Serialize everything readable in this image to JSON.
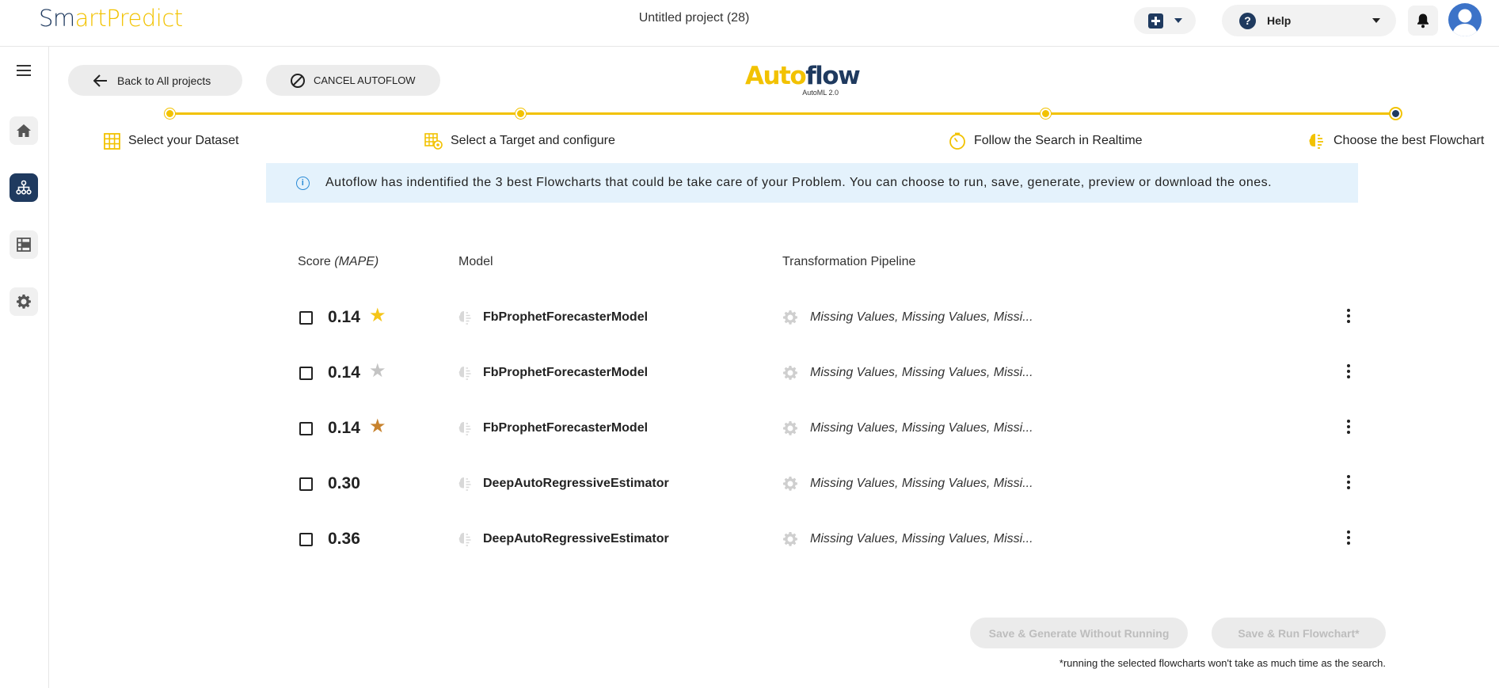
{
  "header": {
    "logo_smart": "Sm",
    "logo_art": "art",
    "logo_predict": "Predict",
    "project_title": "Untitled project (28)",
    "help_label": "Help"
  },
  "actions": {
    "back_label": "Back to All projects",
    "cancel_label": "CANCEL AUTOFLOW"
  },
  "autoflow": {
    "title_a": "Auto",
    "title_b": "flow",
    "subtitle": "AutoML 2.0"
  },
  "steps": [
    {
      "label": "Select your Dataset",
      "icon": "grid-icon"
    },
    {
      "label": "Select a Target and configure",
      "icon": "target-table-icon"
    },
    {
      "label": "Follow the Search in Realtime",
      "icon": "timer-icon"
    },
    {
      "label": "Choose the best Flowchart",
      "icon": "brain-icon"
    }
  ],
  "banner": {
    "text": "Autoflow has indentified the 3 best Flowcharts that could be take care of your Problem. You can choose to run, save, generate, preview or download the ones."
  },
  "table": {
    "headers": {
      "score": "Score",
      "score_metric": "(MAPE)",
      "model": "Model",
      "pipeline": "Transformation Pipeline"
    },
    "rows": [
      {
        "score": "0.14",
        "medal": "gold",
        "medal_color": "#f5c518",
        "model": "FbProphetForecasterModel",
        "pipeline": "Missing Values, Missing Values, Missi..."
      },
      {
        "score": "0.14",
        "medal": "silver",
        "medal_color": "#c4c4c4",
        "model": "FbProphetForecasterModel",
        "pipeline": "Missing Values, Missing Values, Missi..."
      },
      {
        "score": "0.14",
        "medal": "bronze",
        "medal_color": "#c8832e",
        "model": "FbProphetForecasterModel",
        "pipeline": "Missing Values, Missing Values, Missi..."
      },
      {
        "score": "0.30",
        "medal": "",
        "medal_color": "",
        "model": "DeepAutoRegressiveEstimator",
        "pipeline": "Missing Values, Missing Values, Missi..."
      },
      {
        "score": "0.36",
        "medal": "",
        "medal_color": "",
        "model": "DeepAutoRegressiveEstimator",
        "pipeline": "Missing Values, Missing Values, Missi..."
      }
    ]
  },
  "footer": {
    "save_generate_label": "Save & Generate Without Running",
    "save_run_label": "Save & Run Flowchart*",
    "note": "*running the selected flowcharts won't take as much time as the search."
  },
  "colors": {
    "brand_navy": "#1f3a5f",
    "brand_yellow": "#f2c200",
    "banner_bg": "#e4f2fc",
    "disabled_text": "#bdbdbd"
  }
}
